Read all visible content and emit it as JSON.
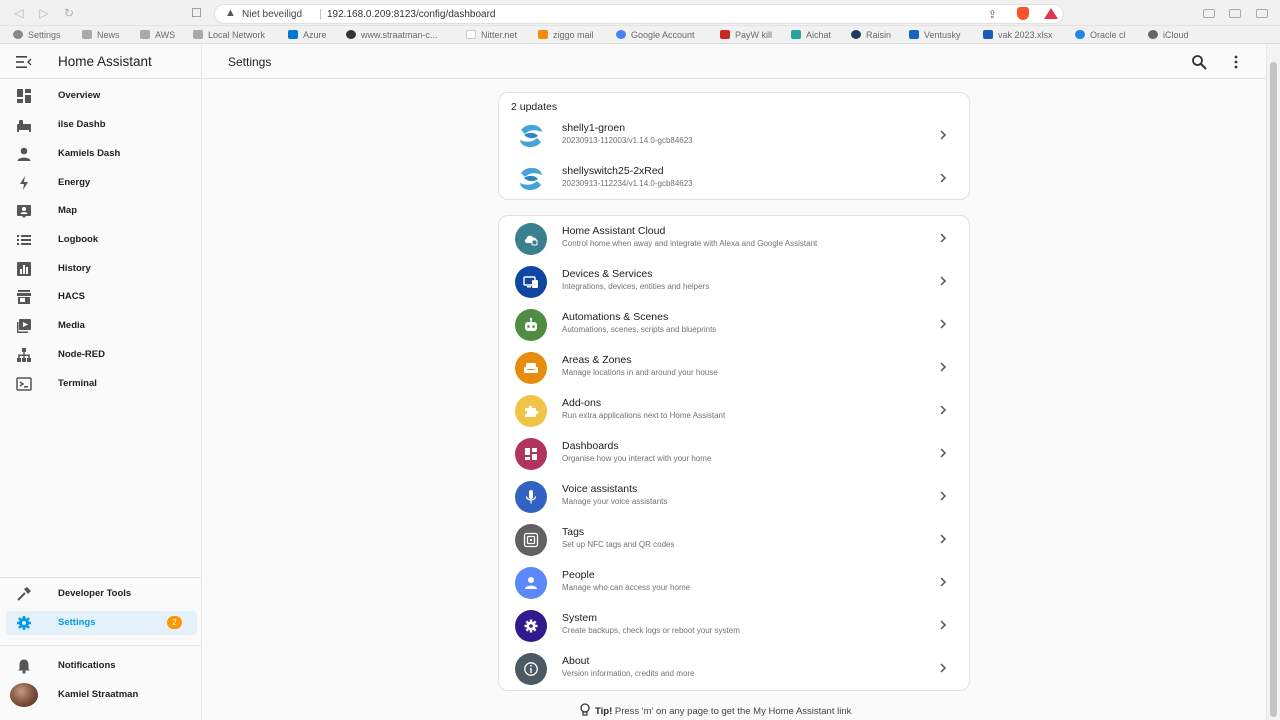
{
  "browser": {
    "not_secure_label": "Niet beveiligd",
    "url": "192.168.0.209:8123/config/dashboard",
    "bookmarks": [
      {
        "label": "Settings",
        "color": "#777777"
      },
      {
        "label": "News",
        "color": "#9e9e9e"
      },
      {
        "label": "AWS",
        "color": "#9e9e9e"
      },
      {
        "label": "Local Network",
        "color": "#9e9e9e"
      },
      {
        "label": "Azure",
        "color": "#0078d4"
      },
      {
        "label": "www.straatman-c...",
        "color": "#333333"
      },
      {
        "label": "Nitter.net",
        "color": "#ffffff"
      },
      {
        "label": "ziggo mail",
        "color": "#f48c06"
      },
      {
        "label": "Google Account",
        "color": "#4285f4"
      },
      {
        "label": "PayW kill",
        "color": "#c62828"
      },
      {
        "label": "Aichat",
        "color": "#26a69a"
      },
      {
        "label": "Raisin",
        "color": "#1e3a5f"
      },
      {
        "label": "Ventusky",
        "color": "#1565c0"
      },
      {
        "label": "vak 2023.xlsx",
        "color": "#1e5bb8"
      },
      {
        "label": "Oracle cl",
        "color": "#1e88e5"
      },
      {
        "label": "iCloud",
        "color": "#666666"
      }
    ]
  },
  "sidebar": {
    "title": "Home Assistant",
    "items": [
      {
        "label": "Overview",
        "icon": "view-dashboard-icon"
      },
      {
        "label": "ilse Dashb",
        "icon": "sofa-icon"
      },
      {
        "label": "Kamiels Dash",
        "icon": "account-icon"
      },
      {
        "label": "Energy",
        "icon": "lightning-bolt-icon"
      },
      {
        "label": "Map",
        "icon": "map-account-icon"
      },
      {
        "label": "Logbook",
        "icon": "format-list-icon"
      },
      {
        "label": "History",
        "icon": "chart-box-icon"
      },
      {
        "label": "HACS",
        "icon": "store-icon"
      },
      {
        "label": "Media",
        "icon": "play-box-icon"
      },
      {
        "label": "Node-RED",
        "icon": "sitemap-icon"
      },
      {
        "label": "Terminal",
        "icon": "console-icon"
      }
    ],
    "developer_tools": "Developer Tools",
    "settings": "Settings",
    "settings_badge": "2",
    "notifications": "Notifications",
    "user_name": "Kamiel Straatman"
  },
  "header": {
    "title": "Settings"
  },
  "updates": {
    "title": "2 updates",
    "items": [
      {
        "name": "shelly1-groen",
        "version": "20230913-112003/v1.14.0-gcb84623"
      },
      {
        "name": "shellyswitch25-2xRed",
        "version": "20230913-112234/v1.14.0-gcb84623"
      }
    ]
  },
  "menu": [
    {
      "title": "Home Assistant Cloud",
      "desc": "Control home when away and integrate with Alexa and Google Assistant",
      "color": "#3b808e",
      "icon": "cloud-lock-icon"
    },
    {
      "title": "Devices & Services",
      "desc": "Integrations, devices, entities and helpers",
      "color": "#0d47a1",
      "icon": "devices-icon"
    },
    {
      "title": "Automations & Scenes",
      "desc": "Automations, scenes, scripts and blueprints",
      "color": "#518c43",
      "icon": "robot-icon"
    },
    {
      "title": "Areas & Zones",
      "desc": "Manage locations in and around your house",
      "color": "#e68d0d",
      "icon": "sofa-icon"
    },
    {
      "title": "Add-ons",
      "desc": "Run extra applications next to Home Assistant",
      "color": "#f1c447",
      "icon": "puzzle-icon"
    },
    {
      "title": "Dashboards",
      "desc": "Organise how you interact with your home",
      "color": "#b1345c",
      "icon": "view-dashboard-icon"
    },
    {
      "title": "Voice assistants",
      "desc": "Manage your voice assistants",
      "color": "#3263c3",
      "icon": "microphone-icon"
    },
    {
      "title": "Tags",
      "desc": "Set up NFC tags and QR codes",
      "color": "#616161",
      "icon": "nfc-icon"
    },
    {
      "title": "People",
      "desc": "Manage who can access your home",
      "color": "#5a87fa",
      "icon": "account-icon"
    },
    {
      "title": "System",
      "desc": "Create backups, check logs or reboot your system",
      "color": "#301a8e",
      "icon": "cog-icon"
    },
    {
      "title": "About",
      "desc": "Version information, credits and more",
      "color": "#4a5963",
      "icon": "information-icon"
    }
  ],
  "tip": {
    "label": "Tip!",
    "text": " Press 'm' on any page to get the My Home Assistant link"
  }
}
